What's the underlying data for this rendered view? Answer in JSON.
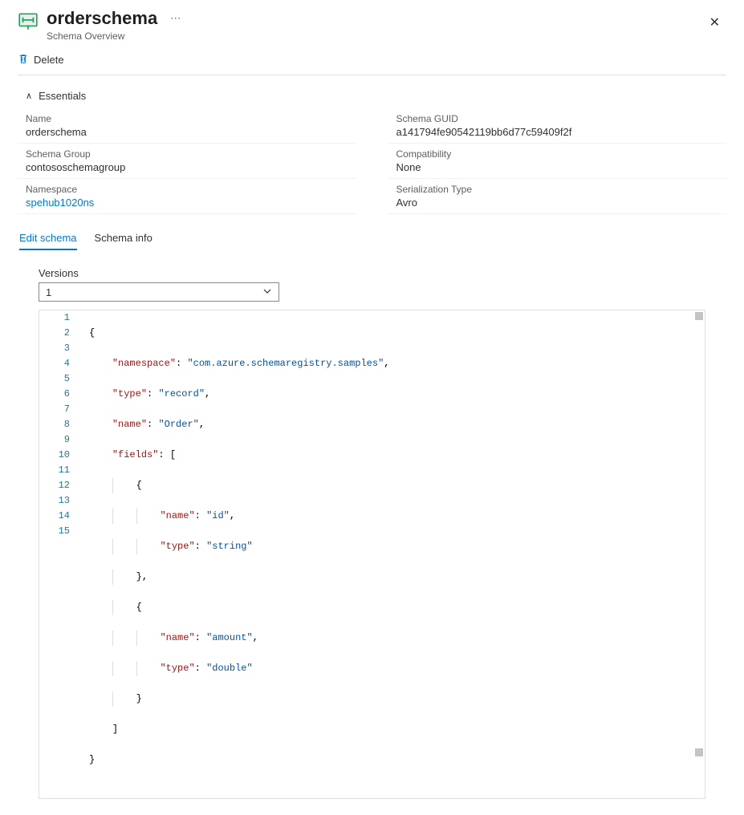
{
  "header": {
    "title": "orderschema",
    "subtitle": "Schema Overview"
  },
  "toolbar": {
    "delete_label": "Delete"
  },
  "essentials": {
    "heading": "Essentials",
    "items": {
      "name_label": "Name",
      "name_value": "orderschema",
      "guid_label": "Schema GUID",
      "guid_value": "a141794fe90542119bb6d77c59409f2f",
      "group_label": "Schema Group",
      "group_value": "contososchemagroup",
      "compat_label": "Compatibility",
      "compat_value": "None",
      "ns_label": "Namespace",
      "ns_value": "spehub1020ns",
      "ser_label": "Serialization Type",
      "ser_value": "Avro"
    }
  },
  "tabs": {
    "edit": "Edit schema",
    "info": "Schema info"
  },
  "versions": {
    "label": "Versions",
    "selected": "1"
  },
  "editor": {
    "line_count": 15,
    "schema": {
      "namespace_key": "\"namespace\"",
      "namespace_val": "\"com.azure.schemaregistry.samples\"",
      "type_key": "\"type\"",
      "type_val": "\"record\"",
      "name_key": "\"name\"",
      "name_val": "\"Order\"",
      "fields_key": "\"fields\"",
      "f1_name_key": "\"name\"",
      "f1_name_val": "\"id\"",
      "f1_type_key": "\"type\"",
      "f1_type_val": "\"string\"",
      "f2_name_key": "\"name\"",
      "f2_name_val": "\"amount\"",
      "f2_type_key": "\"type\"",
      "f2_type_val": "\"double\""
    }
  }
}
